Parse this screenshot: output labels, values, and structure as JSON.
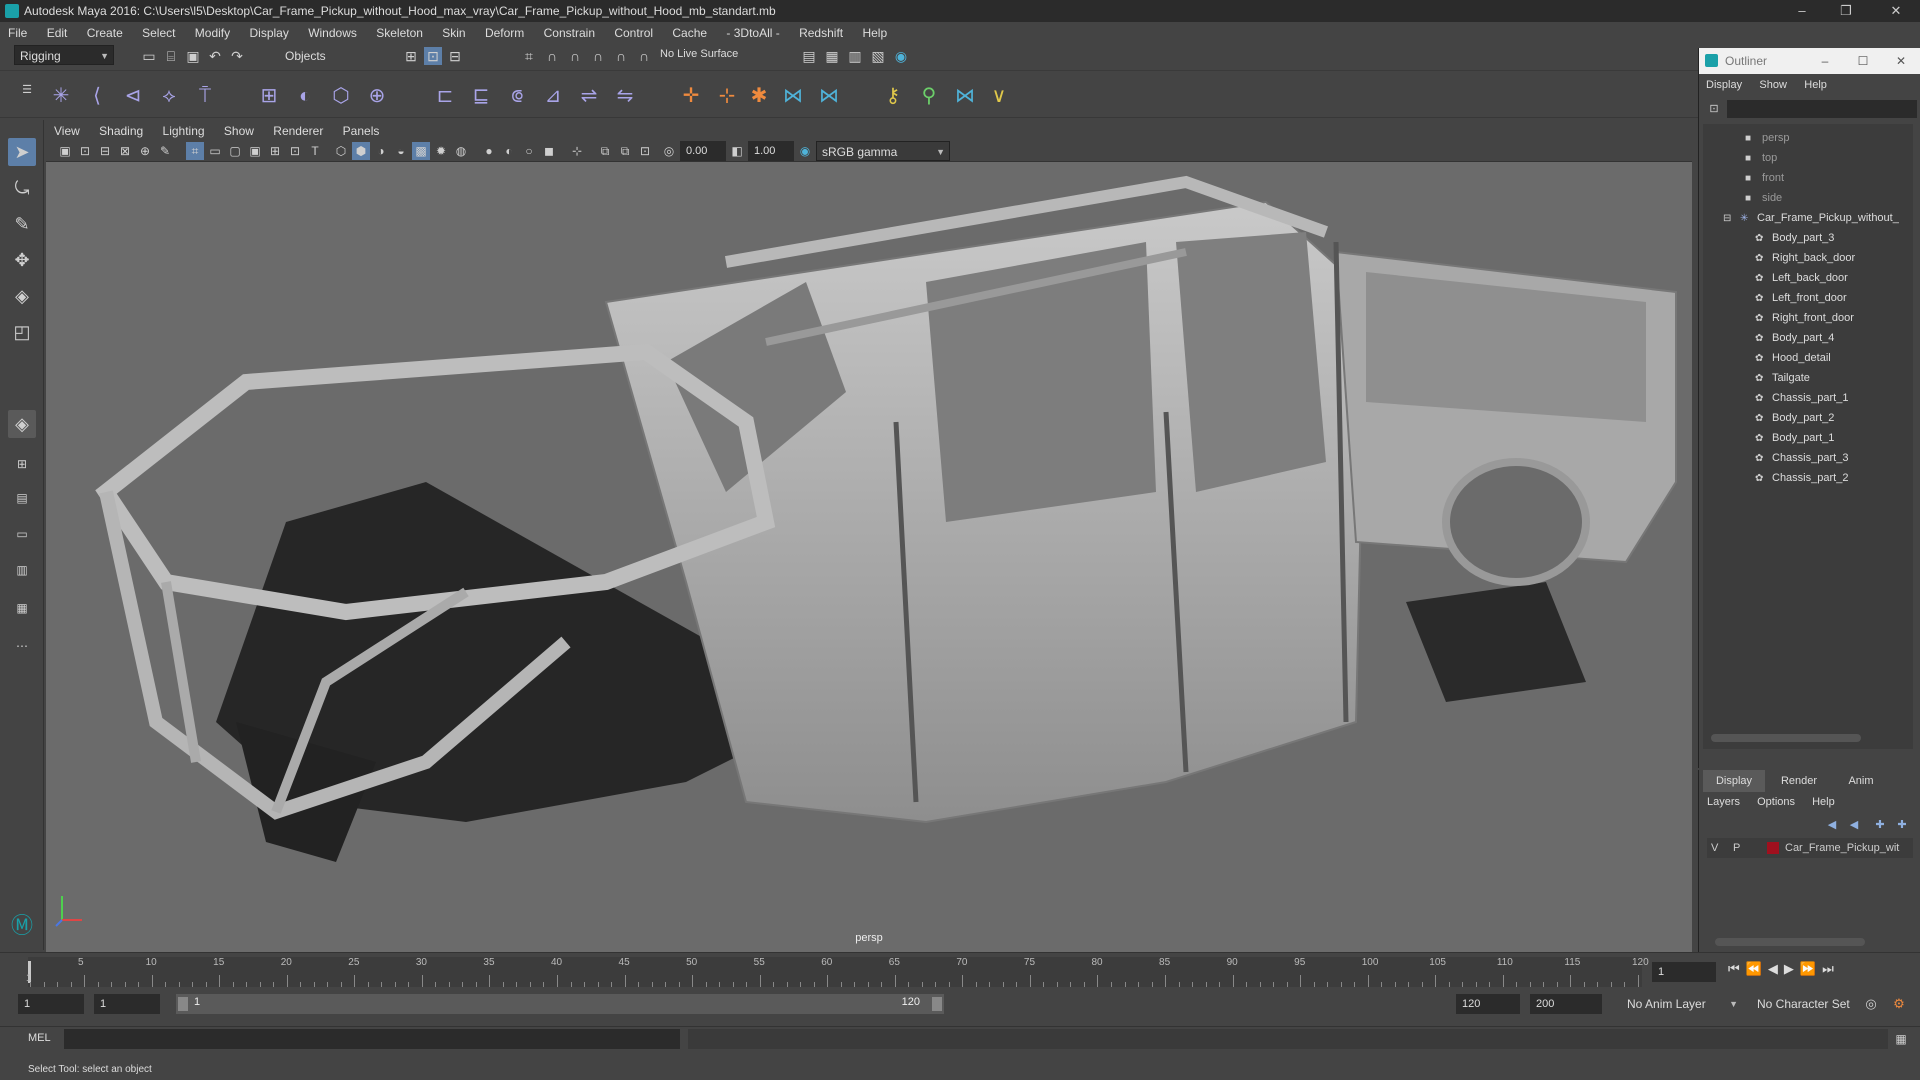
{
  "window": {
    "title": "Autodesk Maya 2016: C:\\Users\\l5\\Desktop\\Car_Frame_Pickup_without_Hood_max_vray\\Car_Frame_Pickup_without_Hood_mb_standart.mb",
    "minimize": "–",
    "maximize": "❐",
    "close": "✕"
  },
  "menubar": [
    "File",
    "Edit",
    "Create",
    "Select",
    "Modify",
    "Display",
    "Windows",
    "Skeleton",
    "Skin",
    "Deform",
    "Constrain",
    "Control",
    "Cache",
    "- 3DtoAll -",
    "Redshift",
    "Help"
  ],
  "statusline": {
    "menuset": "Rigging",
    "selection_mask": "Objects",
    "live_surface": "No Live Surface"
  },
  "viewport": {
    "menu": [
      "View",
      "Shading",
      "Lighting",
      "Show",
      "Renderer",
      "Panels"
    ],
    "near_value": "0.00",
    "far_value": "1.00",
    "color_space": "sRGB gamma",
    "camera_label": "persp"
  },
  "outliner": {
    "title": "Outliner",
    "menu": [
      "Display",
      "Show",
      "Help"
    ],
    "cameras": [
      "persp",
      "top",
      "front",
      "side"
    ],
    "root": "Car_Frame_Pickup_without_",
    "children": [
      "Body_part_3",
      "Right_back_door",
      "Left_back_door",
      "Left_front_door",
      "Right_front_door",
      "Body_part_4",
      "Hood_detail",
      "Tailgate",
      "Chassis_part_1",
      "Body_part_2",
      "Body_part_1",
      "Chassis_part_3",
      "Chassis_part_2"
    ]
  },
  "layer_editor": {
    "tabs": [
      "Display",
      "Render",
      "Anim"
    ],
    "menu": [
      "Layers",
      "Options",
      "Help"
    ],
    "layer": {
      "v": "V",
      "p": "P",
      "name": "Car_Frame_Pickup_wit",
      "color": "#a0101e"
    }
  },
  "timeline": {
    "labels": [
      "5",
      "10",
      "15",
      "20",
      "25",
      "30",
      "35",
      "40",
      "45",
      "50",
      "55",
      "60",
      "65",
      "70",
      "75",
      "80",
      "85",
      "90",
      "95",
      "100",
      "105",
      "110",
      "115",
      "120"
    ],
    "start_label": "1",
    "current_frame": "1"
  },
  "range": {
    "start": "1",
    "playback_start": "1",
    "slider_start": "1",
    "slider_end": "120",
    "playback_end": "120",
    "end": "200",
    "anim_layer": "No Anim Layer",
    "character_set": "No Character Set"
  },
  "command": {
    "language": "MEL"
  },
  "help_line": "Select Tool: select an object"
}
